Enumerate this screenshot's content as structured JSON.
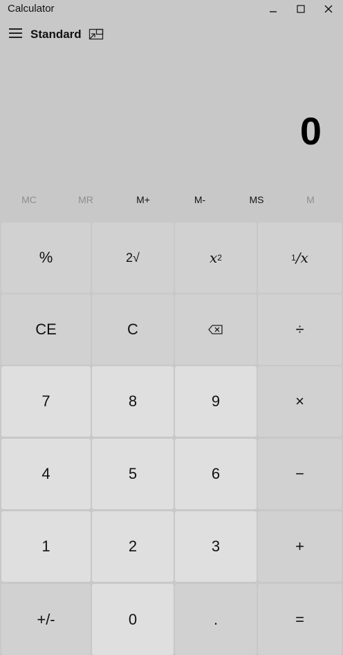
{
  "window": {
    "title": "Calculator",
    "minimize_label": "–",
    "maximize_label": "☐",
    "close_label": "✕"
  },
  "header": {
    "mode_title": "Standard",
    "menu_icon": "hamburger-icon",
    "keep_on_top_icon": "keep-on-top-icon"
  },
  "display": {
    "value": "0"
  },
  "memory": [
    {
      "label": "MC",
      "enabled": false
    },
    {
      "label": "MR",
      "enabled": false
    },
    {
      "label": "M+",
      "enabled": true
    },
    {
      "label": "M-",
      "enabled": true
    },
    {
      "label": "MS",
      "enabled": true
    },
    {
      "label": "M",
      "enabled": false
    }
  ],
  "keys": {
    "percent": "%",
    "sqrt": "2√",
    "square_base": "x",
    "square_exp": "2",
    "reciprocal_num": "1",
    "reciprocal_den": "/x",
    "clear_entry": "CE",
    "clear": "C",
    "backspace_icon": "backspace-icon",
    "divide": "÷",
    "seven": "7",
    "eight": "8",
    "nine": "9",
    "multiply": "×",
    "four": "4",
    "five": "5",
    "six": "6",
    "minus": "−",
    "one": "1",
    "two": "2",
    "three": "3",
    "plus": "+",
    "negate": "+/-",
    "zero": "0",
    "decimal": ".",
    "equals": "="
  },
  "colors": {
    "background": "#c8c8c8",
    "function_key": "#d1d1d1",
    "number_key": "#dfdfdf",
    "disabled_text": "#8e8e8e"
  }
}
